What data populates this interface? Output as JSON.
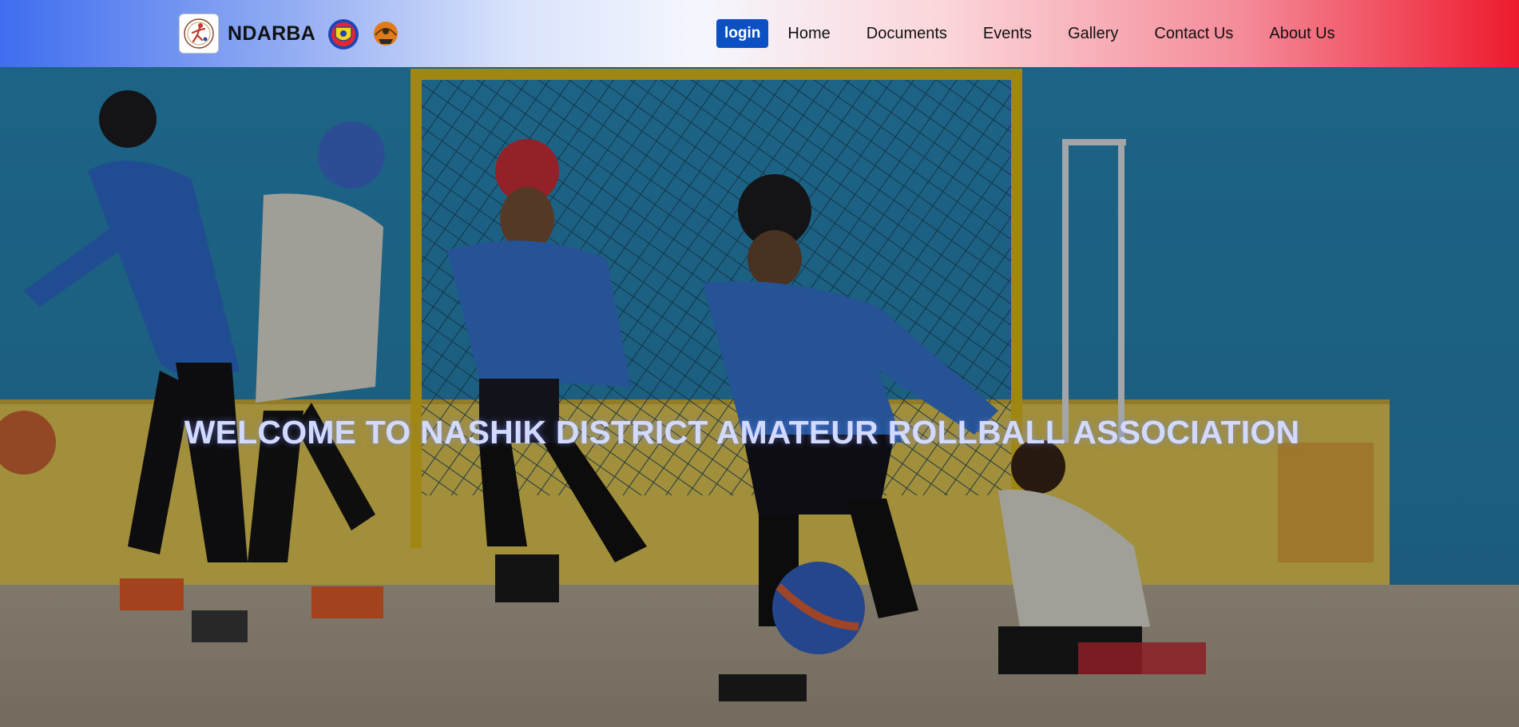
{
  "brand": {
    "name": "NDARBA"
  },
  "nav": {
    "login": "login",
    "items": [
      "Home",
      "Documents",
      "Events",
      "Gallery",
      "Contact Us",
      "About Us"
    ]
  },
  "hero": {
    "title": "WELCOME TO NASHIK DISTRICT AMATEUR ROLLBALL ASSOCIATION"
  },
  "colors": {
    "login_bg": "#0d50c4",
    "nav_left": "#3f6df0",
    "nav_right": "#ee1a2d",
    "hero_text": "#d2daff"
  },
  "icons": [
    "rollball-logo-icon",
    "federation-emblem-icon",
    "association-emblem-icon"
  ]
}
